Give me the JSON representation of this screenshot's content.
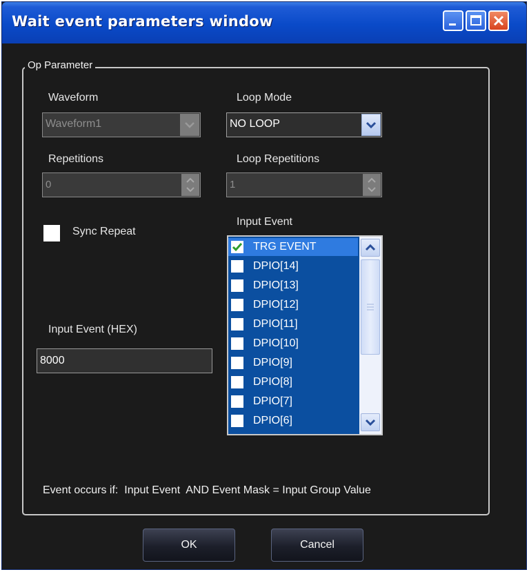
{
  "window": {
    "title": "Wait event parameters window",
    "controls": {
      "minimize": "minimize-icon",
      "maximize": "maximize-icon",
      "close": "close-icon"
    }
  },
  "group": {
    "label": "Op Parameter"
  },
  "waveform": {
    "label": "Waveform",
    "value": "Waveform1",
    "enabled": false
  },
  "loop_mode": {
    "label": "Loop Mode",
    "value": "NO LOOP",
    "enabled": true
  },
  "repetitions": {
    "label": "Repetitions",
    "value": "0",
    "enabled": false
  },
  "loop_repetitions": {
    "label": "Loop Repetitions",
    "value": "1",
    "enabled": false
  },
  "sync_repeat": {
    "label": "Sync Repeat",
    "checked": false
  },
  "input_event": {
    "label": "Input Event",
    "items": [
      {
        "label": "TRG EVENT",
        "checked": true,
        "selected": true
      },
      {
        "label": "DPIO[14]",
        "checked": false
      },
      {
        "label": "DPIO[13]",
        "checked": false
      },
      {
        "label": "DPIO[12]",
        "checked": false
      },
      {
        "label": "DPIO[11]",
        "checked": false
      },
      {
        "label": "DPIO[10]",
        "checked": false
      },
      {
        "label": "DPIO[9]",
        "checked": false
      },
      {
        "label": "DPIO[8]",
        "checked": false
      },
      {
        "label": "DPIO[7]",
        "checked": false
      },
      {
        "label": "DPIO[6]",
        "checked": false
      }
    ]
  },
  "input_event_hex": {
    "label": "Input Event (HEX)",
    "value": "8000"
  },
  "note": "Event occurs if:  Input Event  AND Event Mask = Input Group Value",
  "buttons": {
    "ok": "OK",
    "cancel": "Cancel"
  },
  "colors": {
    "titlebar": "#0a4ac8",
    "background": "#1b1b1b",
    "list_bg": "#0b4fa0",
    "list_selected": "#2f7be0",
    "check": "#2e9e2e"
  }
}
